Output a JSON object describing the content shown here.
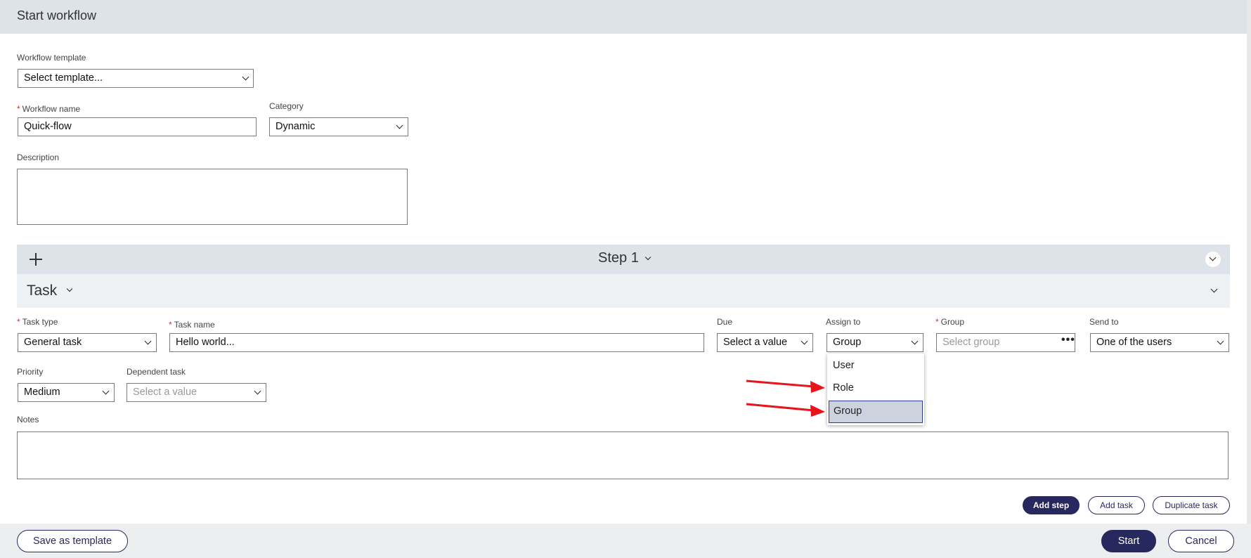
{
  "header": {
    "title": "Start workflow"
  },
  "form": {
    "template_label": "Workflow template",
    "template_value": "Select template...",
    "name_label": "Workflow name",
    "name_value": "Quick-flow",
    "category_label": "Category",
    "category_value": "Dynamic",
    "description_label": "Description"
  },
  "step": {
    "label": "Step 1"
  },
  "task": {
    "header_label": "Task",
    "type_label": "Task type",
    "type_value": "General task",
    "name_label": "Task name",
    "name_value": "Hello world...",
    "due_label": "Due",
    "due_value": "Select a value",
    "assign_label": "Assign to",
    "assign_value": "Group",
    "group_label": "Group",
    "group_placeholder": "Select group",
    "sendto_label": "Send to",
    "sendto_value": "One of the users",
    "priority_label": "Priority",
    "priority_value": "Medium",
    "dependent_label": "Dependent task",
    "dependent_placeholder": "Select a value",
    "notes_label": "Notes"
  },
  "assign_dropdown": {
    "options": [
      "User",
      "Role",
      "Group"
    ],
    "selected": "Group"
  },
  "actions": {
    "add_step": "Add step",
    "add_task": "Add task",
    "duplicate_task": "Duplicate task"
  },
  "footer": {
    "save_template": "Save as template",
    "start": "Start",
    "cancel": "Cancel"
  },
  "colors": {
    "primary": "#27285e",
    "header_bg": "#dde3e8",
    "required": "#d0312d",
    "annotation_arrow": "#e8141b"
  },
  "icons": [
    "plus-icon",
    "chevron-down-icon",
    "more-dots-icon",
    "annotation-arrow-icon"
  ]
}
